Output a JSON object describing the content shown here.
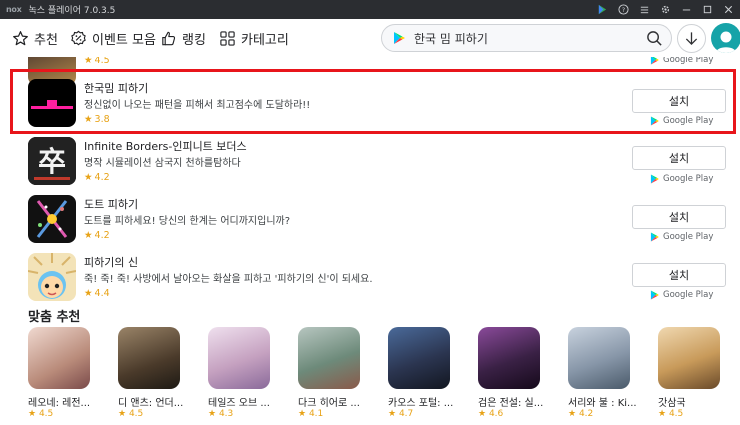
{
  "titlebar": {
    "logo": "nox",
    "title": "녹스 플레이어 7.0.3.5"
  },
  "nav": {
    "tabs": [
      {
        "label": "추천",
        "icon": "star-icon"
      },
      {
        "label": "이벤트 모음",
        "icon": "discount-icon"
      },
      {
        "label": "랭킹",
        "icon": "thumbs-up-icon"
      },
      {
        "label": "카테고리",
        "icon": "grid-icon"
      }
    ],
    "search_value": "한국 밈 피하기"
  },
  "partial_row": {
    "rating": "4.5",
    "store": "Google Play"
  },
  "apps": [
    {
      "name": "한국밈 피하기",
      "desc": "정신없이 나오는 패턴을 피해서 최고점수에 도달하라!!",
      "rating": "3.8",
      "install": "설치",
      "store": "Google Play",
      "icon": "dodge-game-icon"
    },
    {
      "name": "Infinite Borders-인피니트 보더스",
      "desc": "명작 시뮬레이션 삼국지 천하를탐하다",
      "rating": "4.2",
      "install": "설치",
      "store": "Google Play",
      "icon": "infinite-borders-icon"
    },
    {
      "name": "도트 피하기",
      "desc": "도트를 피하세요! 당신의 한계는 어디까지입니까?",
      "rating": "4.2",
      "install": "설치",
      "store": "Google Play",
      "icon": "dot-dodge-icon"
    },
    {
      "name": "피하기의 신",
      "desc": "죽! 죽! 죽! 사방에서 날아오는 화살을 피하고 '피하기의 신'이 되세요.",
      "rating": "4.4",
      "install": "설치",
      "store": "Google Play",
      "icon": "dodge-god-icon"
    }
  ],
  "recommend": {
    "title": "맞춤 추천",
    "items": [
      {
        "name": "레오네: 레전...",
        "rating": "4.5",
        "color": "#d9b8a8"
      },
      {
        "name": "디 앤츠: 언더...",
        "rating": "4.5",
        "color": "#5a4a38"
      },
      {
        "name": "테일즈 오브 ...",
        "rating": "4.3",
        "color": "#c9a9c2"
      },
      {
        "name": "다크 히어로 ...",
        "rating": "4.1",
        "color": "#6d8a7a"
      },
      {
        "name": "카오스 포털: ...",
        "rating": "4.7",
        "color": "#2b3550"
      },
      {
        "name": "검은 전설: 실...",
        "rating": "4.6",
        "color": "#3a2145"
      },
      {
        "name": "서리와 불 : Ki...",
        "rating": "4.2",
        "color": "#8796a8"
      },
      {
        "name": "갓삼국",
        "rating": "4.5",
        "color": "#c89a5a"
      }
    ]
  },
  "colors": {
    "highlight": "#e8151b",
    "rating": "#e8a317",
    "avatar": "#16a3a8"
  }
}
